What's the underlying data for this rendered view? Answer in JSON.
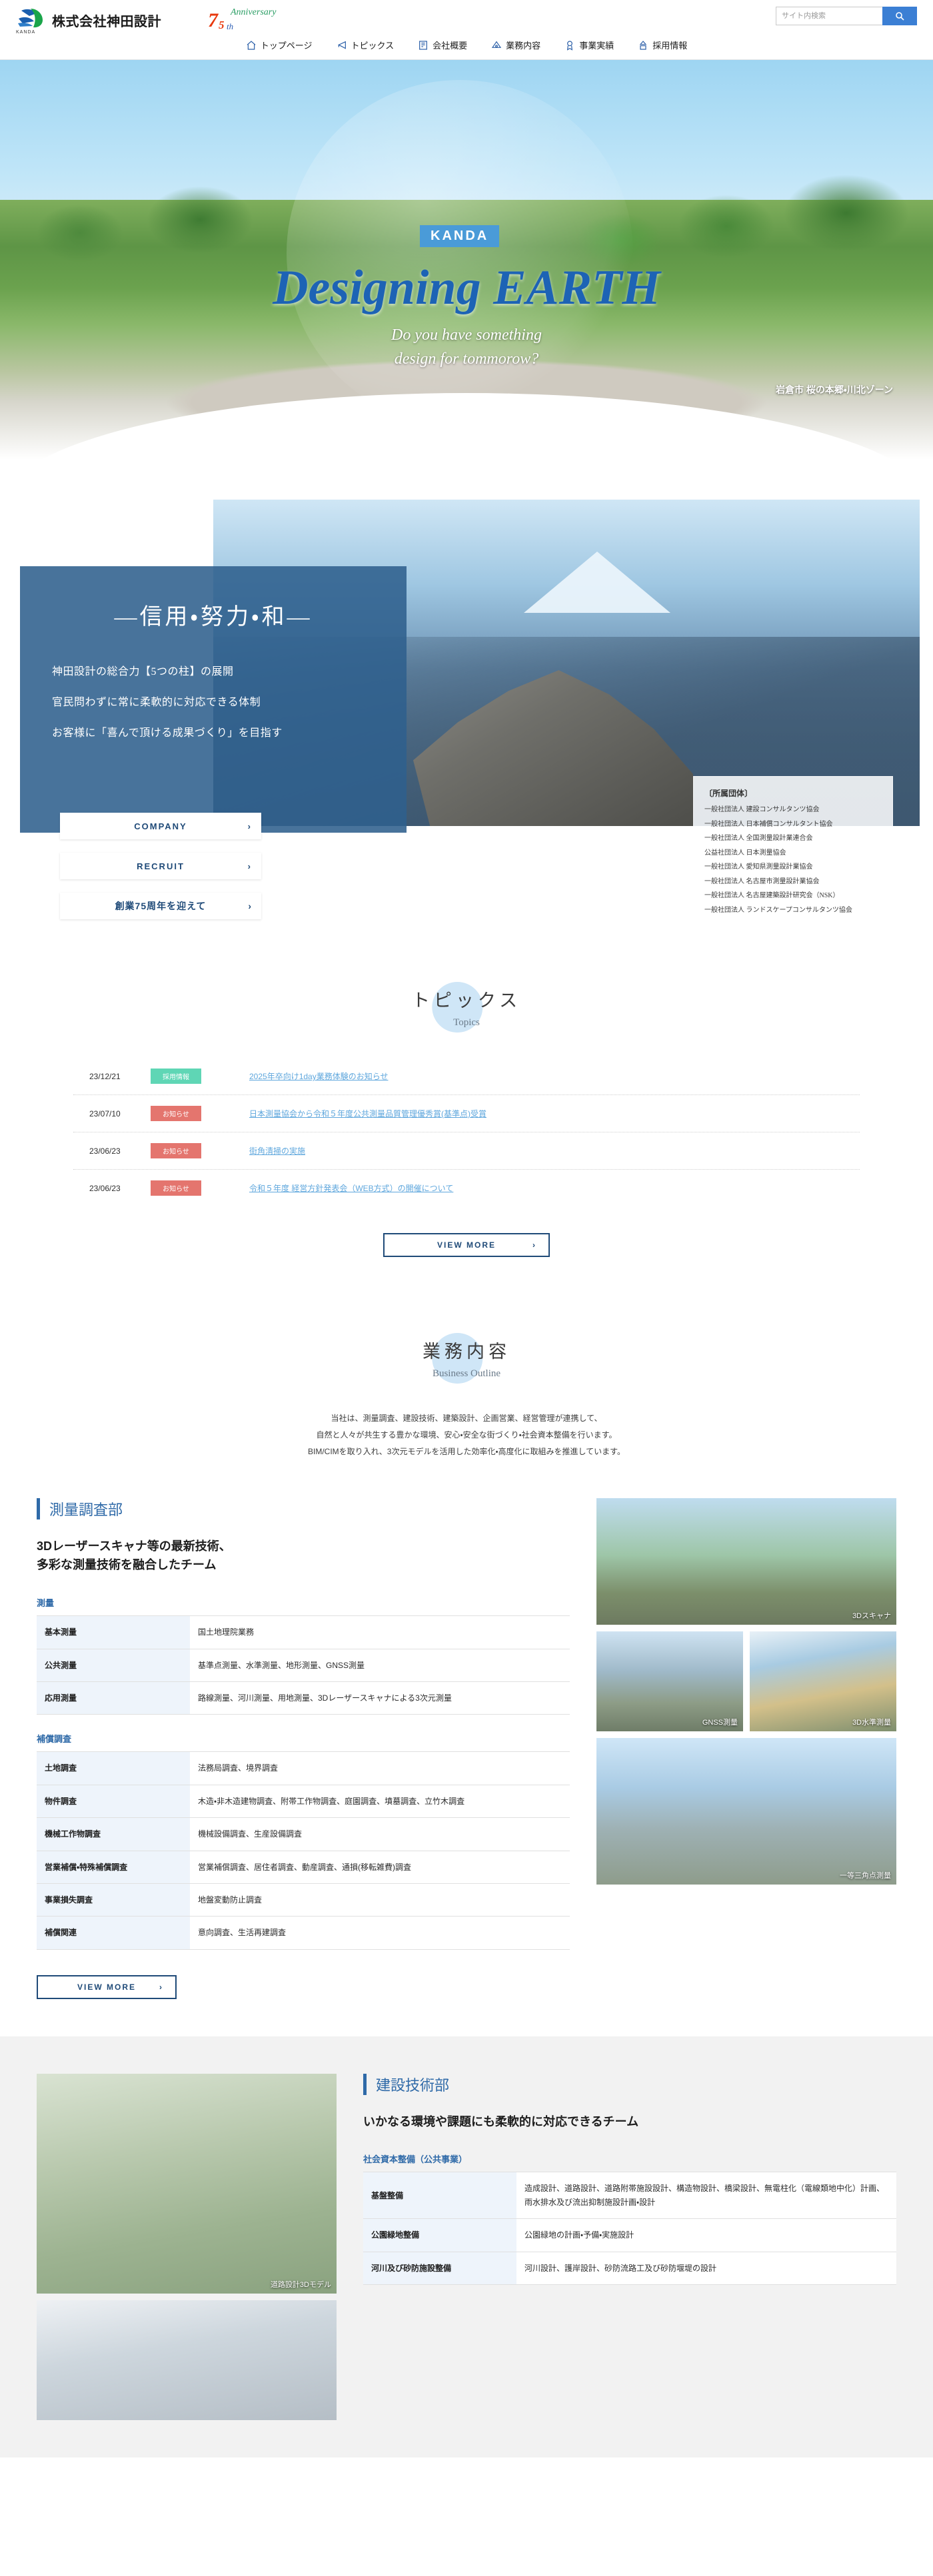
{
  "header": {
    "company_name": "株式会社神田設計",
    "logo_sub": "KANDA",
    "anniversary": {
      "num": "7",
      "five": "5",
      "th": "th",
      "word": "Anniversary"
    },
    "search": {
      "placeholder": "サイト内検索",
      "value": "",
      "icon": "search-icon"
    },
    "nav": [
      {
        "label": "トップページ",
        "icon": "home-icon"
      },
      {
        "label": "トピックス",
        "icon": "megaphone-icon"
      },
      {
        "label": "会社概要",
        "icon": "building-icon"
      },
      {
        "label": "業務内容",
        "icon": "compass-icon"
      },
      {
        "label": "事業実績",
        "icon": "award-icon"
      },
      {
        "label": "採用情報",
        "icon": "person-icon"
      }
    ]
  },
  "hero": {
    "badge": "KANDA",
    "title": "Designing EARTH",
    "subtitle_line1": "Do you have something",
    "subtitle_line2": "design for tommorow?",
    "caption": "岩倉市 桜の本郷・川北ゾーン"
  },
  "philosophy": {
    "heading": "―信用・努力・和―",
    "lines": [
      "神田設計の総合力【5つの柱】の展開",
      "官民問わずに常に柔軟的に対応できる体制",
      "お客様に「喜んで頂ける成果づくり」を目指す"
    ],
    "buttons": [
      {
        "label": "COMPANY",
        "chevron": "›"
      },
      {
        "label": "RECRUIT",
        "chevron": "›"
      },
      {
        "label": "創業75周年を迎えて",
        "chevron": "›"
      }
    ],
    "affiliations_title": "〔所属団体〕",
    "affiliations": [
      "一般社団法人 建設コンサルタンツ協会",
      "一般社団法人 日本補償コンサルタント協会",
      "一般社団法人 全国測量設計業連合会",
      "公益社団法人 日本測量協会",
      "一般社団法人 愛知県測量設計業協会",
      "一般社団法人 名古屋市測量設計業協会",
      "一般社団法人 名古屋建築設計研究会（NSK）",
      "一般社団法人 ランドスケープコンサルタンツ協会"
    ]
  },
  "topics": {
    "title_jp": "トピックス",
    "title_en": "Topics",
    "items": [
      {
        "date": "23/12/21",
        "badge": "採用情報",
        "badge_type": "recruit",
        "link": "2025年卒向け1day業務体験のお知らせ"
      },
      {
        "date": "23/07/10",
        "badge": "お知らせ",
        "badge_type": "news",
        "link": "日本測量協会から令和５年度公共測量品質管理優秀賞(基準点)受賞"
      },
      {
        "date": "23/06/23",
        "badge": "お知らせ",
        "badge_type": "news",
        "link": "街角清掃の実施"
      },
      {
        "date": "23/06/23",
        "badge": "お知らせ",
        "badge_type": "news",
        "link": "令和５年度 経営方針発表会（WEB方式）の開催について"
      }
    ],
    "view_more": "VIEW MORE",
    "chevron": "›"
  },
  "business": {
    "title_jp": "業務内容",
    "title_en": "Business Outline",
    "description_lines": [
      "当社は、測量調査、建設技術、建築設計、企画営業、経営管理が連携して、",
      "自然と人々が共生する豊かな環境、安心・安全な街づくり・社会資本整備を行います。",
      "BIM/CIMを取り入れ、3次元モデルを活用した効率化・高度化に取組みを推進しています。"
    ]
  },
  "dept_survey": {
    "name": "測量調査部",
    "tagline_line1": "3Dレーザースキャナ等の最新技術、",
    "tagline_line2": "多彩な測量技術を融合したチーム",
    "group1_label": "測量",
    "group1_rows": [
      {
        "k": "基本測量",
        "v": "国土地理院業務"
      },
      {
        "k": "公共測量",
        "v": "基準点測量、水準測量、地形測量、GNSS測量"
      },
      {
        "k": "応用測量",
        "v": "路線測量、河川測量、用地測量、3Dレーザースキャナによる3次元測量"
      }
    ],
    "group2_label": "補償調査",
    "group2_rows": [
      {
        "k": "土地調査",
        "v": "法務局調査、境界調査"
      },
      {
        "k": "物件調査",
        "v": "木造・非木造建物調査、附帯工作物調査、庭園調査、墳墓調査、立竹木調査"
      },
      {
        "k": "機械工作物調査",
        "v": "機械設備調査、生産設備調査"
      },
      {
        "k": "営業補償・特殊補償調査",
        "v": "営業補償調査、居住者調査、動産調査、通損(移転雑費)調査"
      },
      {
        "k": "事業損失調査",
        "v": "地盤変動防止調査"
      },
      {
        "k": "補償関連",
        "v": "意向調査、生活再建調査"
      }
    ],
    "view_more": "VIEW MORE",
    "chevron": "›",
    "photos": [
      {
        "caption": "3Dスキャナ",
        "name": "photo-3d-scanner"
      },
      {
        "caption": "GNSS測量",
        "name": "photo-gnss"
      },
      {
        "caption": "3D水準測量",
        "name": "photo-level"
      },
      {
        "caption": "一等三角点測量",
        "name": "photo-triangulation"
      }
    ]
  },
  "dept_construction": {
    "name": "建設技術部",
    "tagline_line1": "いかなる環境や課題にも柔軟的に対応できるチーム",
    "group1_label": "社会資本整備（公共事業）",
    "group1_rows": [
      {
        "k": "基盤整備",
        "v": "造成設計、道路設計、道路附帯施設設計、構造物設計、橋梁設計、無電柱化（電線類地中化）計画、雨水排水及び流出抑制施設計画・設計"
      },
      {
        "k": "公園緑地整備",
        "v": "公園緑地の計画・予備・実施設計"
      },
      {
        "k": "河川及び砂防施設整備",
        "v": "河川設計、護岸設計、砂防流路工及び砂防堰堤の設計"
      }
    ],
    "photos": [
      {
        "caption": "道路設計3Dモデル",
        "name": "photo-road-3d"
      },
      {
        "caption": "",
        "name": "photo-construction"
      }
    ]
  }
}
